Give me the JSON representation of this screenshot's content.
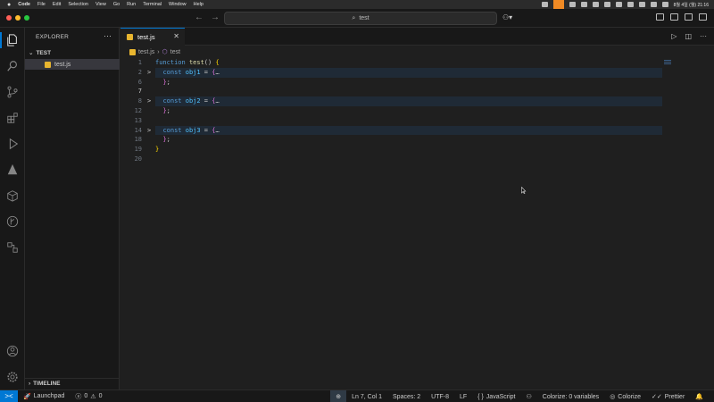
{
  "menubar": {
    "app": "Code",
    "items": [
      "File",
      "Edit",
      "Selection",
      "View",
      "Go",
      "Run",
      "Terminal",
      "Window",
      "Help"
    ],
    "clock": "8월 4일 (월) 21:16"
  },
  "titlebar": {
    "search_text": "test",
    "search_icon": "search-icon"
  },
  "activity_icons": [
    "explorer-icon",
    "search-icon",
    "source-control-icon",
    "extensions-icon",
    "run-debug-icon",
    "deploy-icon",
    "package-icon",
    "git-graph-icon",
    "remote-explorer-icon",
    "account-icon",
    "settings-gear-icon"
  ],
  "sidebar": {
    "title": "EXPLORER",
    "more": "···",
    "folder": "TEST",
    "file": "test.js",
    "timeline": "TIMELINE"
  },
  "editor": {
    "tab_label": "test.js",
    "tab_close": "✕",
    "breadcrumb_file": "test.js",
    "breadcrumb_symbol": "test",
    "lines": [
      {
        "num": "1",
        "fold": "",
        "text": "function test() {"
      },
      {
        "num": "2",
        "fold": ">",
        "text": "const obj1 = {…"
      },
      {
        "num": "6",
        "fold": "",
        "text": "};"
      },
      {
        "num": "7",
        "fold": "",
        "text": ""
      },
      {
        "num": "8",
        "fold": ">",
        "text": "const obj2 = {…"
      },
      {
        "num": "12",
        "fold": "",
        "text": "};"
      },
      {
        "num": "13",
        "fold": "",
        "text": ""
      },
      {
        "num": "14",
        "fold": ">",
        "text": "const obj3 = {…"
      },
      {
        "num": "18",
        "fold": "",
        "text": "};"
      },
      {
        "num": "19",
        "fold": "",
        "text": "}"
      },
      {
        "num": "20",
        "fold": "",
        "text": ""
      }
    ]
  },
  "statusbar": {
    "remote": "><",
    "launchpad": "Launchpad",
    "errors": "0",
    "warnings": "0",
    "position": "Ln 7, Col 1",
    "spaces": "Spaces: 2",
    "encoding": "UTF-8",
    "eol": "LF",
    "language_braces": "{ }",
    "language": "JavaScript",
    "colorize_vars": "Colorize: 0 variables",
    "colorize": "Colorize",
    "prettier": "Prettier"
  },
  "colors": {
    "accent": "#0078d4",
    "keyword": "#569cd6",
    "function": "#dcdcaa",
    "variable": "#4fc1ff",
    "brace": "#ffd700",
    "inner_brace": "#da70d6"
  }
}
